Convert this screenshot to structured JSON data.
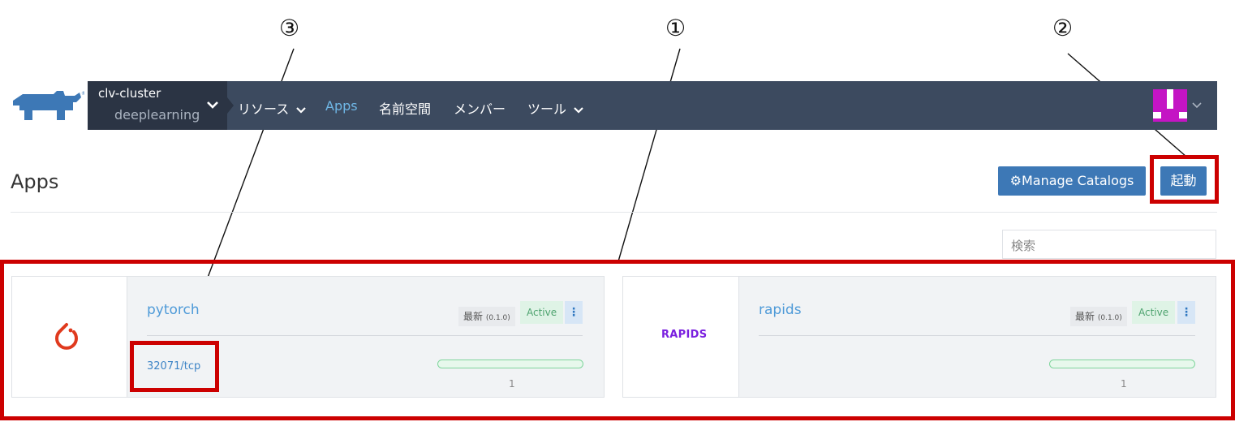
{
  "nav": {
    "cluster": "clv-cluster",
    "project": "deeplearning",
    "items": [
      {
        "label": "リソース",
        "has_dropdown": true
      },
      {
        "label": "Apps",
        "active": true
      },
      {
        "label": "名前空間"
      },
      {
        "label": "メンバー"
      },
      {
        "label": "ツール",
        "has_dropdown": true
      }
    ],
    "accent_color": "#3c4a5f"
  },
  "page": {
    "title": "Apps",
    "manage_catalogs_label": "Manage Catalogs",
    "launch_label": "起動",
    "search_placeholder": "検索"
  },
  "apps": [
    {
      "name": "pytorch",
      "version_label": "最新",
      "version": "(0.1.0)",
      "status": "Active",
      "endpoint": "32071/tcp",
      "count": "1",
      "logo": "pytorch-flame-icon"
    },
    {
      "name": "rapids",
      "version_label": "最新",
      "version": "(0.1.0)",
      "status": "Active",
      "count": "1",
      "logo_text": "RAPIDS"
    }
  ],
  "annotations": {
    "callout_1": "①",
    "callout_2": "②",
    "callout_3": "③"
  }
}
